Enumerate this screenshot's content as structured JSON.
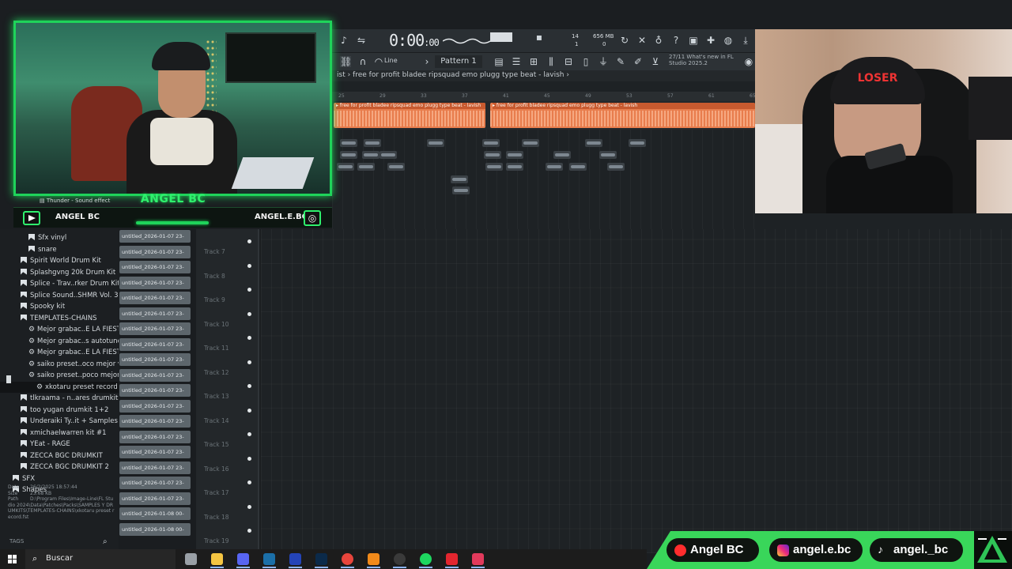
{
  "fl": {
    "time": "0:00",
    "time_ms": ":00",
    "cpu_line1": "14",
    "cpu_line2": "1",
    "mem_line1": "656 MB",
    "mem_line2": "0",
    "snap_label": "Line",
    "pattern": "Pattern 1",
    "hint_line1": "27/11  What's new in FL",
    "hint_line2": "Studio 2025.2",
    "breadcrumb": "ist › free for profit bladee  ripsquad  emo plugg type beat - lavish ›",
    "clip_label_1": "▸ free for profit bladee  ripsquad  emo plugg type beat - lavish",
    "clip_label_2": "▸ free for profit bladee  ripsquad  emo plugg type beat - lavish",
    "ruler_ticks": [
      "25",
      "29",
      "33",
      "37",
      "41",
      "45",
      "49",
      "53",
      "57",
      "61",
      "65"
    ]
  },
  "browser": {
    "items": [
      {
        "label": "Sfx vinyl",
        "kind": "folder",
        "indent": 2
      },
      {
        "label": "snare",
        "kind": "folder",
        "indent": 2
      },
      {
        "label": "Spirit World Drum Kit",
        "kind": "folder",
        "indent": 1
      },
      {
        "label": "Splashgvng 20k Drum Kit",
        "kind": "folder",
        "indent": 1
      },
      {
        "label": "Splice - Trav..rker Drum Kit",
        "kind": "folder",
        "indent": 1
      },
      {
        "label": "Splice Sound..SHMR Vol. 3",
        "kind": "folder",
        "indent": 1
      },
      {
        "label": "Spooky kit",
        "kind": "folder",
        "indent": 1
      },
      {
        "label": "TEMPLATES-CHAINS",
        "kind": "folder-open",
        "indent": 1
      },
      {
        "label": "Mejor grabac..E LA FIESTA",
        "kind": "gear",
        "indent": 2
      },
      {
        "label": "Mejor grabac..s autotune)",
        "kind": "gear",
        "indent": 2
      },
      {
        "label": "Mejor grabac..E LA FIESTA",
        "kind": "gear",
        "indent": 2
      },
      {
        "label": "saiko preset..oco mejor v2",
        "kind": "gear",
        "indent": 2
      },
      {
        "label": "saiko preset..poco mejor",
        "kind": "gear",
        "indent": 2
      },
      {
        "label": "xkotaru preset record",
        "kind": "gear",
        "indent": 3
      },
      {
        "label": "tlkraama - n..ares drumkit",
        "kind": "folder",
        "indent": 1
      },
      {
        "label": "too yugan drumkit 1+2",
        "kind": "folder",
        "indent": 1
      },
      {
        "label": "Underaiki Ty..it + Samples",
        "kind": "folder",
        "indent": 1
      },
      {
        "label": "xmichaelwarren kit #1",
        "kind": "folder",
        "indent": 1
      },
      {
        "label": "YEat - RAGE",
        "kind": "folder",
        "indent": 1
      },
      {
        "label": "ZECCA BGC DRUMKIT",
        "kind": "folder",
        "indent": 1
      },
      {
        "label": "ZECCA BGC DRUMKIT 2",
        "kind": "folder",
        "indent": 1
      },
      {
        "label": "SFX",
        "kind": "folder",
        "indent": 0
      },
      {
        "label": "Shapes",
        "kind": "folder",
        "indent": 0
      }
    ],
    "info_date_key": "Date",
    "info_date": "26/2/2025 18:57:44",
    "info_size_key": "Size",
    "info_size": "23.68 KB",
    "info_path_key": "Path",
    "info_path": "D:\\Program Files\\Image-Line\\FL Studio 2024\\Data\\Patches\\Packs\\SAMPLES Y DRUMKITS\\TEMPLATES-CHAINS\\xkotaru preset record.fst",
    "tags_label": "TAGS"
  },
  "clips": [
    "untitled_2026-01-07 23-",
    "untitled_2026-01-07 23-",
    "untitled_2026-01-07 23-",
    "untitled_2026-01-07 23-",
    "untitled_2026-01-07 23-",
    "untitled_2026-01-07 23-",
    "untitled_2026-01-07 23-",
    "untitled_2026-01-07 23-",
    "untitled_2026-01-07 23-",
    "untitled_2026-01-07 23-",
    "untitled_2026-01-07 23-",
    "untitled_2026-01-07 23-",
    "untitled_2026-01-07 23-",
    "untitled_2026-01-07 23-",
    "untitled_2026-01-07 23-",
    "untitled_2026-01-07 23-",
    "untitled_2026-01-07 23-",
    "untitled_2026-01-07 23-",
    "untitled_2026-01-08 00-",
    "untitled_2026-01-08 00-"
  ],
  "tracks": [
    "Track 7",
    "Track 8",
    "Track 9",
    "Track 10",
    "Track 11",
    "Track 12",
    "Track 13",
    "Track 14",
    "Track 15",
    "Track 16",
    "Track 17",
    "Track 18",
    "Track 19"
  ],
  "overlay": {
    "name": "ANGEL BC",
    "thunder": "Thunder - Sound effect",
    "youtube_handle": "ANGEL BC",
    "instagram_handle": "ANGEL.E.BC"
  },
  "socials": {
    "youtube": "Angel BC",
    "instagram": "angel.e.bc",
    "tiktok": "angel._bc",
    "colors": {
      "youtube": "#ff2d2d",
      "instagram": "#d6307a",
      "tiktok": "#25f4ee",
      "bar": "#39d65a"
    }
  },
  "taskbar": {
    "search_placeholder": "Buscar",
    "apps": [
      "task-view-icon",
      "file-explorer-icon",
      "discord-icon",
      "steam-icon",
      "vegas-icon",
      "photoshop-icon",
      "chrome-icon",
      "fl-studio-icon",
      "obs-icon",
      "spotify-icon",
      "app-red-icon",
      "tiktok-icon"
    ]
  },
  "colors": {
    "accent_green": "#1fd35a",
    "waveform": "#e87d4d",
    "daw_bg": "#1e2225"
  }
}
